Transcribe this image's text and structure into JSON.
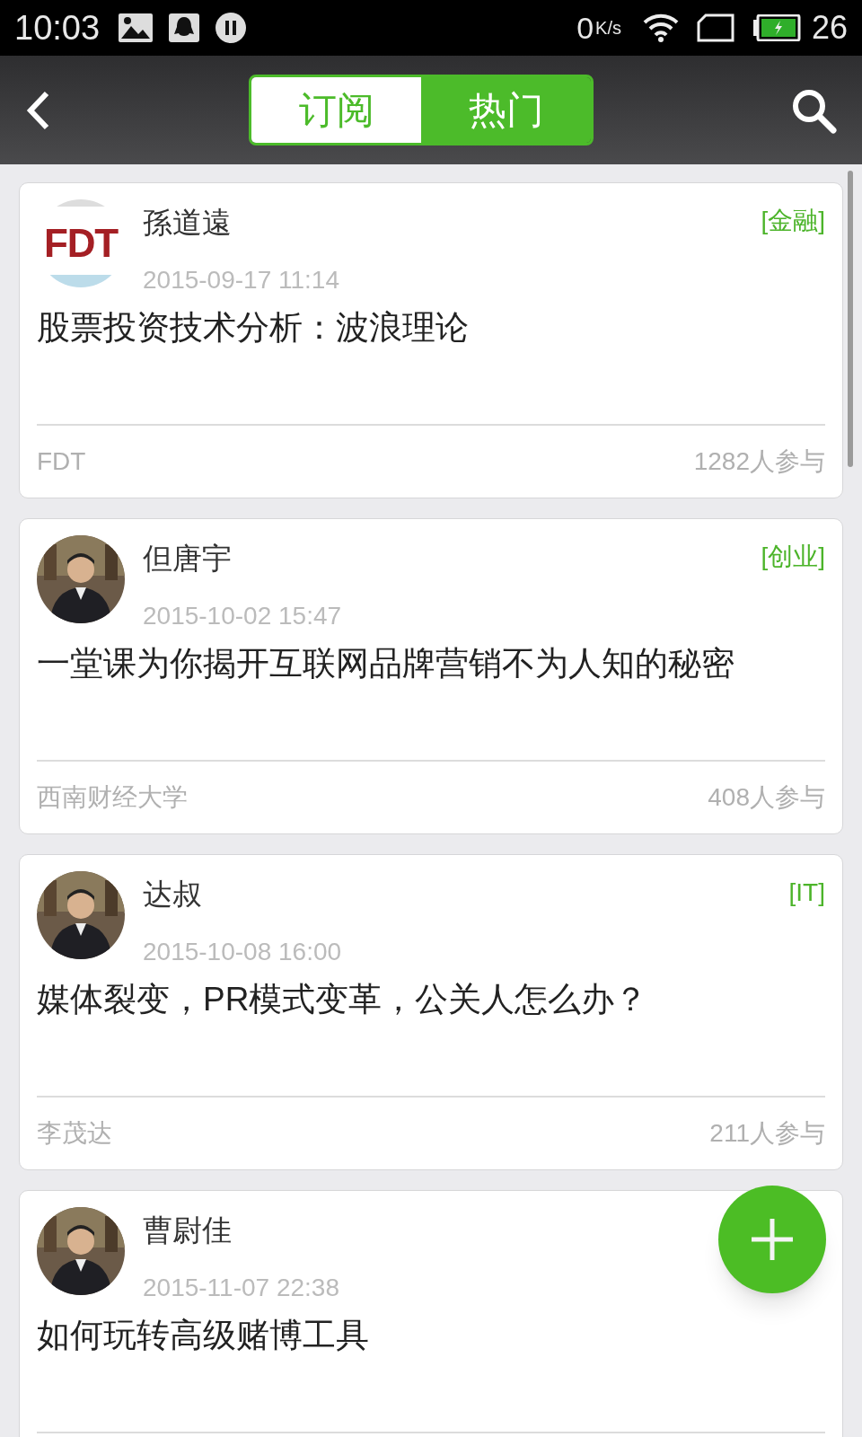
{
  "status_bar": {
    "time": "10:03",
    "speed": "0",
    "speed_unit": "K/s",
    "battery": "26"
  },
  "header": {
    "tabs": [
      {
        "label": "订阅",
        "selected": false
      },
      {
        "label": "热门",
        "selected": true
      }
    ]
  },
  "posts": [
    {
      "author": "孫道遠",
      "avatar": {
        "kind": "logo",
        "text": "FDT"
      },
      "date": "2015-09-17 11:14",
      "tag": "[金融]",
      "title": "股票投资技术分析：波浪理论",
      "source": "FDT",
      "participants": "1282人参与"
    },
    {
      "author": "但唐宇",
      "date": "2015-10-02 15:47",
      "tag": "[创业]",
      "title": "一堂课为你揭开互联网品牌营销不为人知的秘密",
      "source": "西南财经大学",
      "participants": "408人参与"
    },
    {
      "author": "达叔",
      "date": "2015-10-08 16:00",
      "tag": "[IT]",
      "title": "媒体裂变，PR模式变革，公关人怎么办？",
      "source": "李茂达",
      "participants": "211人参与"
    },
    {
      "author": "曹尉佳",
      "date": "2015-11-07 22:38",
      "title": "如何玩转高级赌博工具"
    }
  ]
}
